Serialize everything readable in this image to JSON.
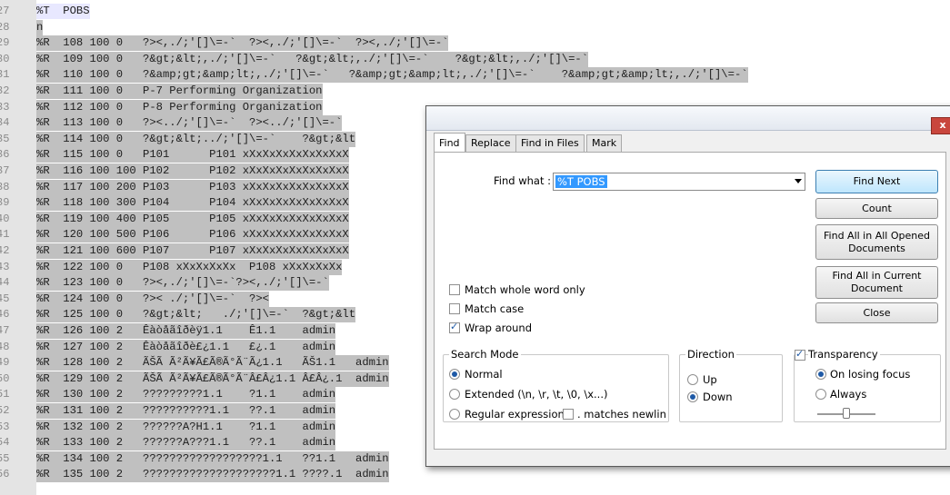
{
  "editor": {
    "lines": [
      {
        "num": "27",
        "text": "%T  POBS",
        "style": "cur"
      },
      {
        "num": "28",
        "text": "n",
        "style": "sel"
      },
      {
        "num": "29",
        "text": "%R  108 100 0   ?><,./;'[]\\=-`  ?><,./;'[]\\=-`  ?><,./;'[]\\=-`",
        "style": "sel"
      },
      {
        "num": "30",
        "text": "%R  109 100 0   ?&gt;&lt;,./;'[]\\=-`   ?&gt;&lt;,./;'[]\\=-`    ?&gt;&lt;,./;'[]\\=-`",
        "style": "sel"
      },
      {
        "num": "31",
        "text": "%R  110 100 0   ?&amp;gt;&amp;lt;,./;'[]\\=-`   ?&amp;gt;&amp;lt;,./;'[]\\=-`    ?&amp;gt;&amp;lt;,./;'[]\\=-`",
        "style": "sel"
      },
      {
        "num": "32",
        "text": "%R  111 100 0   P-7 Performing Organization",
        "style": "sel"
      },
      {
        "num": "33",
        "text": "%R  112 100 0   P-8 Performing Organization",
        "style": "sel"
      },
      {
        "num": "34",
        "text": "%R  113 100 0   ?><../;'[]\\=-`  ?><../;'[]\\=-`",
        "style": "sel"
      },
      {
        "num": "35",
        "text": "%R  114 100 0   ?&gt;&lt;../;'[]\\=-`    ?&gt;&lt",
        "style": "sel"
      },
      {
        "num": "36",
        "text": "%R  115 100 0   P101      P101 xXxXxXxXxXxXxXxX",
        "style": "sel"
      },
      {
        "num": "37",
        "text": "%R  116 100 100 P102      P102 xXxXxXxXxXxXxXxX",
        "style": "sel"
      },
      {
        "num": "38",
        "text": "%R  117 100 200 P103      P103 xXxXxXxXxXxXxXxX",
        "style": "sel"
      },
      {
        "num": "39",
        "text": "%R  118 100 300 P104      P104 xXxXxXxXxXxXxXxX",
        "style": "sel"
      },
      {
        "num": "40",
        "text": "%R  119 100 400 P105      P105 xXxXxXxXxXxXxXxX",
        "style": "sel"
      },
      {
        "num": "41",
        "text": "%R  120 100 500 P106      P106 xXxXxXxXxXxXxXxX",
        "style": "sel"
      },
      {
        "num": "42",
        "text": "%R  121 100 600 P107      P107 xXxXxXxXxXxXxXxX",
        "style": "sel"
      },
      {
        "num": "43",
        "text": "%R  122 100 0   P108 xXxXxXxXx  P108 xXxXxXxXx",
        "style": "sel"
      },
      {
        "num": "44",
        "text": "%R  123 100 0   ?><,./;'[]\\=-`?><,./;'[]\\=-`",
        "style": "sel"
      },
      {
        "num": "45",
        "text": "%R  124 100 0   ?>< ./;'[]\\=-`  ?><",
        "style": "sel"
      },
      {
        "num": "46",
        "text": "%R  125 100 0   ?&gt;&lt;   ./;'[]\\=-`  ?&gt;&lt",
        "style": "sel"
      },
      {
        "num": "47",
        "text": "%R  126 100 2   Êàòåãîðèÿ1.1    Ê1.1    admin",
        "style": "sel"
      },
      {
        "num": "48",
        "text": "%R  127 100 2   Êàòåãîðè£¿1.1   £¿.1    admin",
        "style": "sel"
      },
      {
        "num": "49",
        "text": "%R  128 100 2   ÃŠÃ Ã²Ã¥Ã£Ã®Ã°Ã¨Ã¿1.1   ÃŠ1.1   admin",
        "style": "sel"
      },
      {
        "num": "50",
        "text": "%R  129 100 2   ÃŠÃ Ã²Ã¥Ã£Ã®Ã°Ã¨Â£Â¿1.1 Â£Â¿.1  admin",
        "style": "sel"
      },
      {
        "num": "51",
        "text": "%R  130 100 2   ?????????1.1    ?1.1    admin",
        "style": "sel"
      },
      {
        "num": "52",
        "text": "%R  131 100 2   ??????????1.1   ??.1    admin",
        "style": "sel"
      },
      {
        "num": "53",
        "text": "%R  132 100 2   ??????A?H1.1    ?1.1    admin",
        "style": "sel"
      },
      {
        "num": "54",
        "text": "%R  133 100 2   ??????A???1.1   ??.1    admin",
        "style": "sel"
      },
      {
        "num": "55",
        "text": "%R  134 100 2   ??????????????????1.1   ??1.1   admin",
        "style": "sel"
      },
      {
        "num": "56",
        "text": "%R  135 100 2   ????????????????????1.1 ????.1  admin",
        "style": "sel"
      }
    ]
  },
  "dialog": {
    "close_glyph": "x",
    "tabs": [
      {
        "label": "Find",
        "active": true
      },
      {
        "label": "Replace",
        "active": false
      },
      {
        "label": "Find in Files",
        "active": false
      },
      {
        "label": "Mark",
        "active": false
      }
    ],
    "find_what_label": "Find what :",
    "find_what_value": "%T POBS",
    "buttons": {
      "find_next": "Find Next",
      "count": "Count",
      "find_all_opened": "Find All in All Opened Documents",
      "find_all_current": "Find All in Current Document",
      "close": "Close"
    },
    "options": {
      "match_whole_word": {
        "label": "Match whole word only",
        "checked": false
      },
      "match_case": {
        "label": "Match case",
        "checked": false
      },
      "wrap_around": {
        "label": "Wrap around",
        "checked": true
      }
    },
    "search_mode": {
      "title": "Search Mode",
      "normal": "Normal",
      "extended": "Extended (\\n, \\r, \\t, \\0, \\x...)",
      "regex": "Regular expression",
      "matches_newline": ". matches newlin",
      "selected": "Normal"
    },
    "direction": {
      "title": "Direction",
      "up": "Up",
      "down": "Down",
      "selected": "Down"
    },
    "transparency": {
      "title": "Transparency",
      "checked": true,
      "on_losing_focus": "On losing focus",
      "always": "Always",
      "selected": "On losing focus",
      "level": 0.5
    }
  }
}
